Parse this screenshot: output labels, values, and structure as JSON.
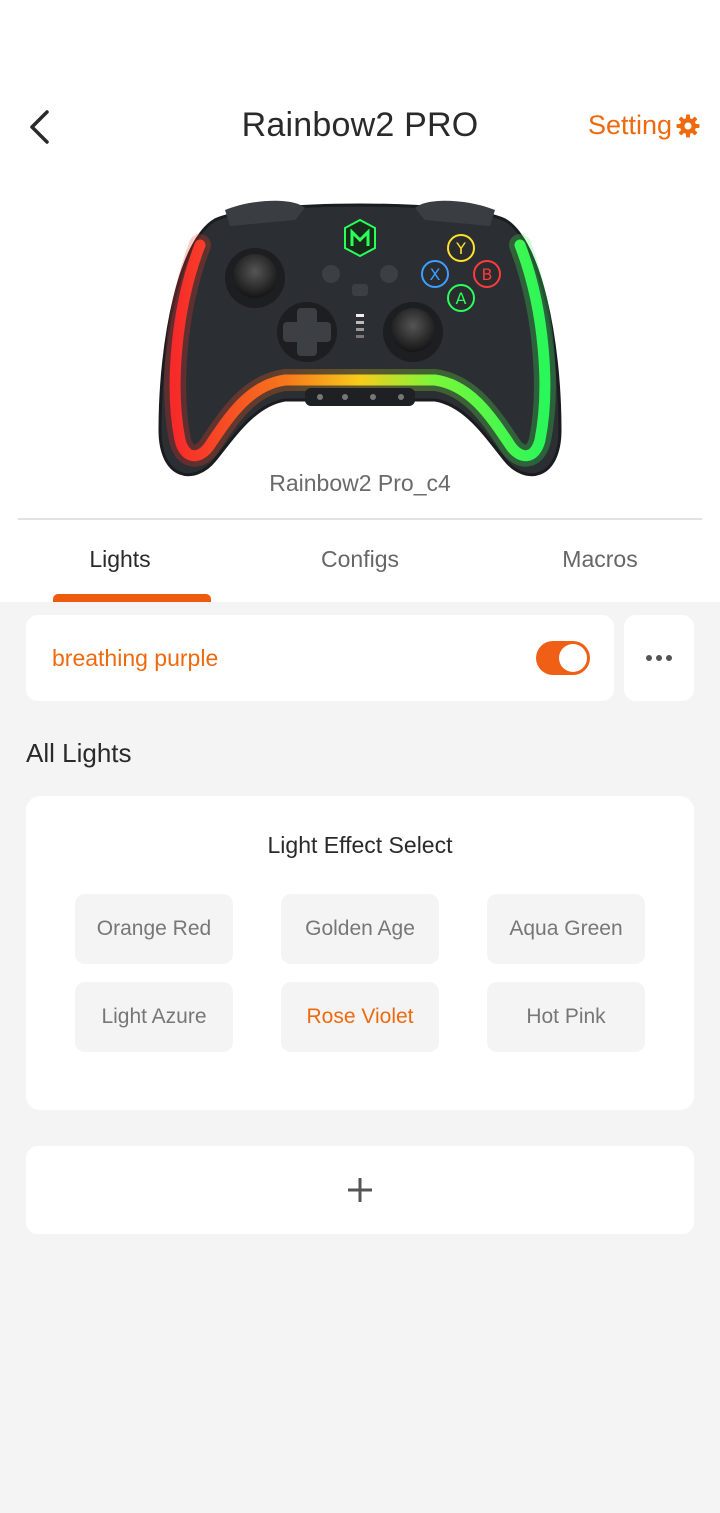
{
  "header": {
    "title": "Rainbow2 PRO",
    "setting_label": "Setting",
    "accent_color": "#ef6a0e"
  },
  "device": {
    "name": "Rainbow2 Pro_c4",
    "buttons": {
      "y": "Y",
      "x": "X",
      "b": "B",
      "a": "A"
    }
  },
  "tabs": [
    {
      "label": "Lights",
      "active": true
    },
    {
      "label": "Configs",
      "active": false
    },
    {
      "label": "Macros",
      "active": false
    }
  ],
  "active_light": {
    "name": "breathing purple",
    "enabled": true
  },
  "section": {
    "title": "All Lights"
  },
  "effects": {
    "title": "Light Effect Select",
    "options": [
      {
        "label": "Orange Red",
        "selected": false
      },
      {
        "label": "Golden Age",
        "selected": false
      },
      {
        "label": "Aqua Green",
        "selected": false
      },
      {
        "label": "Light Azure",
        "selected": false
      },
      {
        "label": "Rose Violet",
        "selected": true
      },
      {
        "label": "Hot Pink",
        "selected": false
      }
    ]
  },
  "icons": {
    "back": "chevron-left-icon",
    "setting": "gear-icon",
    "more": "more-horizontal-icon",
    "add": "plus-icon"
  }
}
